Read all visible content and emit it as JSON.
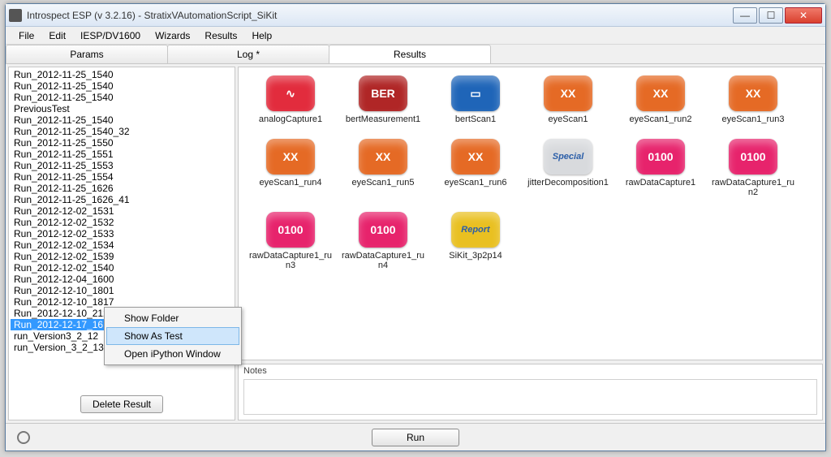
{
  "window": {
    "title": "Introspect ESP (v 3.2.16) - StratixVAutomationScript_SiKit"
  },
  "menu": [
    "File",
    "Edit",
    "IESP/DV1600",
    "Wizards",
    "Results",
    "Help"
  ],
  "tabs": [
    {
      "label": "Params",
      "active": false
    },
    {
      "label": "Log *",
      "active": false
    },
    {
      "label": "Results",
      "active": true
    }
  ],
  "runs": [
    "Run_2012-11-25_1540",
    "Run_2012-11-25_1540",
    "Run_2012-11-25_1540",
    "PreviousTest",
    "Run_2012-11-25_1540",
    "Run_2012-11-25_1540_32",
    "Run_2012-11-25_1550",
    "Run_2012-11-25_1551",
    "Run_2012-11-25_1553",
    "Run_2012-11-25_1554",
    "Run_2012-11-25_1626",
    "Run_2012-11-25_1626_41",
    "Run_2012-12-02_1531",
    "Run_2012-12-02_1532",
    "Run_2012-12-02_1533",
    "Run_2012-12-02_1534",
    "Run_2012-12-02_1539",
    "Run_2012-12-02_1540",
    "Run_2012-12-04_1600",
    "Run_2012-12-10_1801",
    "Run_2012-12-10_1817",
    "Run_2012-12-10_2126",
    "Run_2012-12-17_1617",
    "run_Version3_2_12",
    "run_Version_3_2_13"
  ],
  "selected_run_index": 22,
  "delete_label": "Delete Result",
  "results": [
    {
      "label": "analogCapture1",
      "glyph": "∿",
      "cls": "ic-red"
    },
    {
      "label": "bertMeasurement1",
      "glyph": "BER",
      "cls": "ic-darkred"
    },
    {
      "label": "bertScan1",
      "glyph": "▭",
      "cls": "ic-blue"
    },
    {
      "label": "eyeScan1",
      "glyph": "XX",
      "cls": "ic-orange"
    },
    {
      "label": "eyeScan1_run2",
      "glyph": "XX",
      "cls": "ic-orange"
    },
    {
      "label": "eyeScan1_run3",
      "glyph": "XX",
      "cls": "ic-orange"
    },
    {
      "label": "eyeScan1_run4",
      "glyph": "XX",
      "cls": "ic-orange"
    },
    {
      "label": "eyeScan1_run5",
      "glyph": "XX",
      "cls": "ic-orange"
    },
    {
      "label": "eyeScan1_run6",
      "glyph": "XX",
      "cls": "ic-orange"
    },
    {
      "label": "jitterDecomposition1",
      "glyph": "Special",
      "cls": "ic-grey"
    },
    {
      "label": "rawDataCapture1",
      "glyph": "0100",
      "cls": "ic-pink"
    },
    {
      "label": "rawDataCapture1_run2",
      "glyph": "0100",
      "cls": "ic-pink"
    },
    {
      "label": "rawDataCapture1_run3",
      "glyph": "0100",
      "cls": "ic-pink"
    },
    {
      "label": "rawDataCapture1_run4",
      "glyph": "0100",
      "cls": "ic-pink"
    },
    {
      "label": "SiKit_3p2p14",
      "glyph": "Report",
      "cls": "ic-yellow"
    }
  ],
  "notes_label": "Notes",
  "run_button": "Run",
  "context_menu": [
    {
      "label": "Show Folder",
      "hover": false
    },
    {
      "label": "Show As Test",
      "hover": true
    },
    {
      "label": "Open iPython Window",
      "hover": false
    }
  ]
}
